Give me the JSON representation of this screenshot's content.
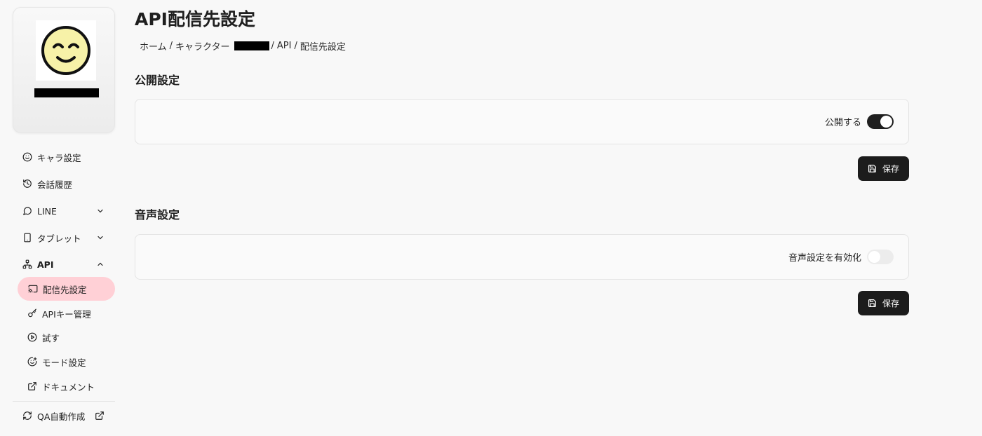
{
  "page": {
    "title": "API配信先設定"
  },
  "breadcrumb": {
    "home": "ホーム",
    "sep": "/",
    "character": "キャラクター",
    "api": "API",
    "current": "配信先設定"
  },
  "sidebar": {
    "items": [
      {
        "label": "キャラ設定",
        "icon": "smile-icon"
      },
      {
        "label": "会話履歴",
        "icon": "history-icon"
      },
      {
        "label": "LINE",
        "icon": "message-circle-icon"
      },
      {
        "label": "タブレット",
        "icon": "tablet-icon"
      },
      {
        "label": "API",
        "icon": "network-icon"
      }
    ],
    "api_subitems": [
      {
        "label": "配信先設定",
        "icon": "cast-icon"
      },
      {
        "label": "APIキー管理",
        "icon": "key-icon"
      },
      {
        "label": "試す",
        "icon": "play-circle-icon"
      },
      {
        "label": "モード設定",
        "icon": "smile-plus-icon"
      },
      {
        "label": "ドキュメント",
        "icon": "external-link-icon"
      }
    ],
    "footer": {
      "label": "QA自動作成",
      "icon": "refresh-icon",
      "trailing_icon": "external-link-icon"
    }
  },
  "sections": {
    "publish": {
      "title": "公開設定",
      "toggle_label": "公開する",
      "enabled": true,
      "save_label": "保存"
    },
    "voice": {
      "title": "音声設定",
      "toggle_label": "音声設定を有効化",
      "enabled": false,
      "save_label": "保存"
    }
  },
  "colors": {
    "accent_active_nav": "#ffd0d6",
    "button_bg": "#1c1c1c",
    "toggle_on": "#1f1f1f",
    "toggle_off": "#ececec"
  }
}
